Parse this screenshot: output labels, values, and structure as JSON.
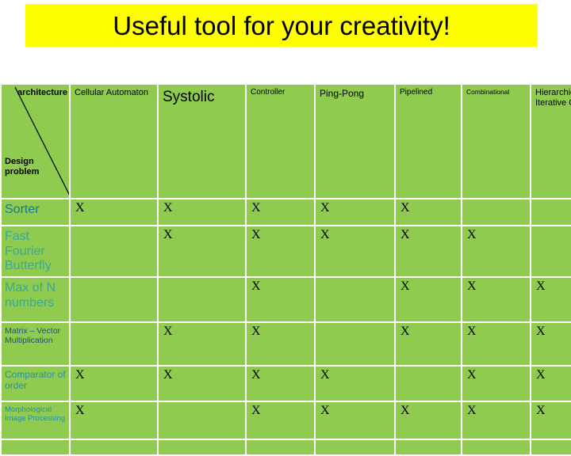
{
  "banner": {
    "title": "Useful tool for your creativity!",
    "background_color": "#ffff00",
    "text_color": "#000000"
  },
  "table": {
    "grid_color": "#8fcb4e",
    "corner": {
      "axis_columns_label": "architecture",
      "axis_rows_label": "Design problem"
    },
    "column_headers": [
      "Cellular Automaton",
      "Systolic",
      "Controller",
      "Ping-Pong",
      "Pipelined",
      "Combinational",
      "Hierarchical Iterative Circuit"
    ],
    "mark": "X",
    "rows": [
      {
        "label": "Sorter",
        "marks": [
          "X",
          "X",
          "X",
          "X",
          "X",
          "",
          ""
        ]
      },
      {
        "label": "Fast Fourier Butterfly",
        "marks": [
          "",
          "X",
          "X",
          "X",
          "X",
          "X",
          ""
        ]
      },
      {
        "label": "Max of N numbers",
        "marks": [
          "",
          "",
          "X",
          "",
          "X",
          "X",
          "X"
        ]
      },
      {
        "label": "Matrix – Vector Multiplication",
        "marks": [
          "",
          "X",
          "X",
          "",
          "X",
          "X",
          "X"
        ]
      },
      {
        "label": "Comparator of order",
        "marks": [
          "X",
          "X",
          "X",
          "X",
          "",
          "X",
          "X"
        ]
      },
      {
        "label": "Morphological Image Processing",
        "marks": [
          "X",
          "",
          "X",
          "X",
          "X",
          "X",
          "X"
        ]
      },
      {
        "label": "",
        "marks": [
          "",
          "",
          "",
          "",
          "",
          "",
          ""
        ]
      }
    ]
  }
}
